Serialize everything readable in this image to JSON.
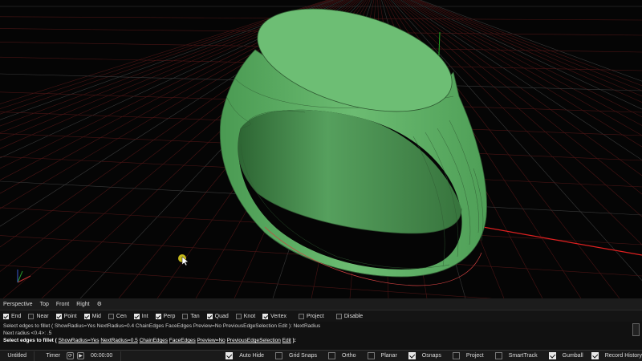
{
  "view_tabs": [
    "Perspective",
    "Top",
    "Front",
    "Right"
  ],
  "view_tabs_add_icon": "gear-icon",
  "osnaps": [
    {
      "label": "End",
      "checked": true
    },
    {
      "label": "Near",
      "checked": false
    },
    {
      "label": "Point",
      "checked": true
    },
    {
      "label": "Mid",
      "checked": true
    },
    {
      "label": "Cen",
      "checked": false
    },
    {
      "label": "Int",
      "checked": true
    },
    {
      "label": "Perp",
      "checked": true
    },
    {
      "label": "Tan",
      "checked": false
    },
    {
      "label": "Quad",
      "checked": true
    },
    {
      "label": "Knot",
      "checked": false
    },
    {
      "label": "Vertex",
      "checked": true
    },
    {
      "label": "Project",
      "checked": false
    },
    {
      "label": "Disable",
      "checked": false
    }
  ],
  "command": {
    "history": [
      "Select edges to fillet ( ShowRadius=Yes  NextRadius=0.4  ChainEdges  FaceEdges  Preview=No  PreviousEdgeSelection  Edit ): NextRadius",
      "Next radius <0.4>: .5"
    ],
    "prompt": {
      "lead": "Select edges to fillet",
      "options": [
        "ShowRadius=Yes",
        "NextRadius=0.5",
        "ChainEdges",
        "FaceEdges",
        "Preview=No",
        "PreviousEdgeSelection",
        "Edit"
      ],
      "tail": "):"
    }
  },
  "status": {
    "document": "Untitled",
    "timer_label": "Timer",
    "timer_value": "00:00:00",
    "toggles": [
      {
        "label": "Auto Hide",
        "checked": true
      },
      {
        "label": "Grid Snaps",
        "checked": false
      },
      {
        "label": "Ortho",
        "checked": false
      },
      {
        "label": "Planar",
        "checked": false
      },
      {
        "label": "Osnaps",
        "checked": true
      },
      {
        "label": "Project",
        "checked": false
      },
      {
        "label": "SmartTrack",
        "checked": false
      },
      {
        "label": "Gumball",
        "checked": true
      },
      {
        "label": "Record History",
        "checked": true
      }
    ]
  },
  "colors": {
    "ring_surface": "#5fae66",
    "ring_top": "#6dbe74",
    "isocurve": "#2f5a32",
    "grid_minor": "#5a1a1a",
    "grid_major": "#2a2a2a",
    "axis_x": "#e02020",
    "axis_y": "#22aa22",
    "cursor": "#e8d820"
  }
}
